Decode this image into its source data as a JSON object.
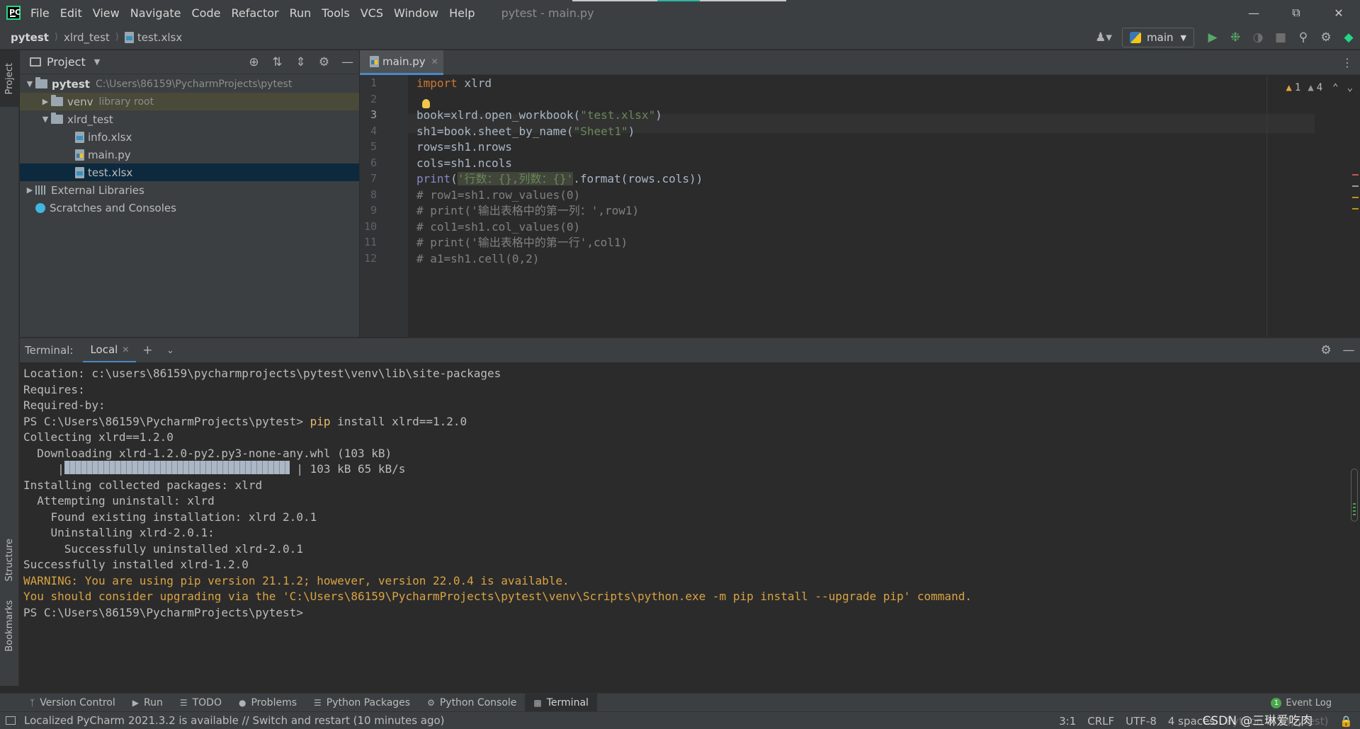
{
  "menubar": {
    "items": [
      "File",
      "Edit",
      "View",
      "Navigate",
      "Code",
      "Refactor",
      "Run",
      "Tools",
      "VCS",
      "Window",
      "Help"
    ],
    "title": "pytest - main.py"
  },
  "navbar": {
    "breadcrumbs": [
      "pytest",
      "xlrd_test",
      "test.xlsx"
    ],
    "run_config": "main"
  },
  "left_stripe": {
    "project": "Project",
    "structure": "Structure",
    "bookmarks": "Bookmarks"
  },
  "project": {
    "title": "Project",
    "tree": [
      {
        "label": "pytest",
        "path": "C:\\Users\\86159\\PycharmProjects\\pytest"
      },
      {
        "label": "venv",
        "path": "library root"
      },
      {
        "label": "xlrd_test"
      },
      {
        "label": "info.xlsx"
      },
      {
        "label": "main.py"
      },
      {
        "label": "test.xlsx"
      },
      {
        "label": "External Libraries"
      },
      {
        "label": "Scratches and Consoles"
      }
    ]
  },
  "editor": {
    "tab": "main.py",
    "line_numbers": [
      "1",
      "2",
      "3",
      "4",
      "5",
      "6",
      "7",
      "8",
      "9",
      "10",
      "11",
      "12"
    ],
    "lines": [
      {
        "kw": "import",
        "text": " xlrd"
      },
      {
        "text": ""
      },
      {
        "a": "book=xlrd.open_workbook(",
        "s": "\"test.xlsx\"",
        "b": ")"
      },
      {
        "a": "sh1=book.sheet_by_name(",
        "s": "\"Sheet1\"",
        "b": ")"
      },
      {
        "text": "rows=sh1.nrows"
      },
      {
        "text": "cols=sh1.ncols"
      },
      {
        "fn": "print",
        "a": "(",
        "s": "'行数：{},列数：{}'",
        "b": ".format(rows.cols))"
      },
      {
        "comment": "# row1=sh1.row_values(0)"
      },
      {
        "comment": "# print('输出表格中的第一列：',row1)"
      },
      {
        "comment": "# col1=sh1.col_values(0)"
      },
      {
        "comment": "# print('输出表格中的第一行',col1)"
      },
      {
        "comment": "# a1=sh1.cell(0,2)"
      }
    ],
    "warnings": "1",
    "weak_warnings": "4"
  },
  "terminal": {
    "label": "Terminal:",
    "tab": "Local",
    "lines": [
      {
        "text": "Location: c:\\users\\86159\\pycharmprojects\\pytest\\venv\\lib\\site-packages"
      },
      {
        "text": "Requires:"
      },
      {
        "text": "Required-by:"
      },
      {
        "prompt": "PS C:\\Users\\86159\\PycharmProjects\\pytest> ",
        "cmd": "pip",
        "rest": " install xlrd==1.2.0"
      },
      {
        "text": "Collecting xlrd==1.2.0"
      },
      {
        "text": "  Downloading xlrd-1.2.0-py2.py3-none-any.whl (103 kB)"
      },
      {
        "text": "     |                                  | 103 kB 65 kB/s"
      },
      {
        "text": "Installing collected packages: xlrd"
      },
      {
        "text": "  Attempting uninstall: xlrd"
      },
      {
        "text": "    Found existing installation: xlrd 2.0.1"
      },
      {
        "text": "    Uninstalling xlrd-2.0.1:"
      },
      {
        "text": "      Successfully uninstalled xlrd-2.0.1"
      },
      {
        "text": "Successfully installed xlrd-1.2.0"
      },
      {
        "warn": "WARNING: You are using pip version 21.1.2; however, version 22.0.4 is available."
      },
      {
        "warn": "You should consider upgrading via the 'C:\\Users\\86159\\PycharmProjects\\pytest\\venv\\Scripts\\python.exe -m pip install --upgrade pip' command."
      },
      {
        "text": "PS C:\\Users\\86159\\PycharmProjects\\pytest>"
      }
    ],
    "download_progress": 1.0
  },
  "bottom_tools": [
    "Version Control",
    "Run",
    "TODO",
    "Problems",
    "Python Packages",
    "Python Console",
    "Terminal"
  ],
  "event_log": {
    "label": "Event Log",
    "count": "1"
  },
  "status": {
    "message": "Localized PyCharm 2021.3.2 is available // Switch and restart (10 minutes ago)",
    "position": "3:1",
    "line_sep": "CRLF",
    "encoding": "UTF-8",
    "indent": "4 spaces",
    "interpreter": "Python 3.7 (pytest)",
    "watermark": "CSDN @三琳爱吃肉"
  },
  "colors": {
    "accent": "#4a88c7",
    "keyword": "#cc7832",
    "string": "#6a8759",
    "warning": "#d9a343"
  }
}
